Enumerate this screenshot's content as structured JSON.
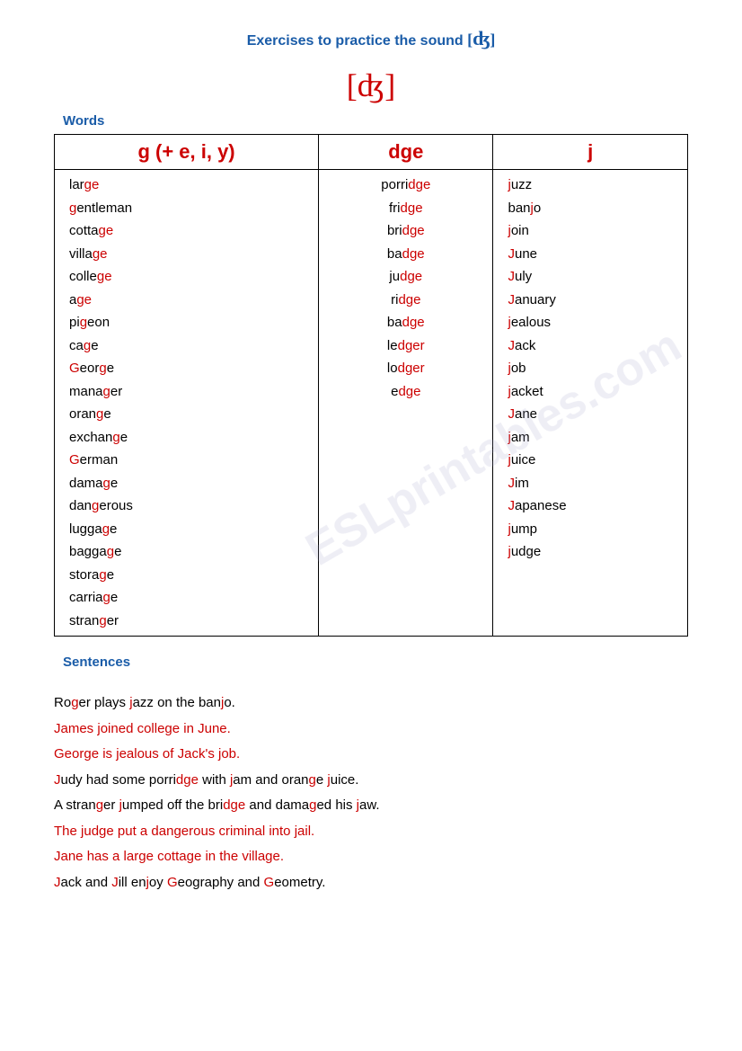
{
  "title": "Exercises to practice the sound",
  "phonetic": "[ʤ]",
  "words_label": "Words",
  "col1_header": "g  (+ e, i, y)",
  "col2_header": "dge",
  "col3_header": "j",
  "col1_words": [
    {
      "text": "lar",
      "highlight": "ge"
    },
    {
      "text": "g",
      "highlight": "g",
      "word": "gentleman",
      "pre": "",
      "mid": "g",
      "post": "entleman"
    },
    {
      "text": "cotta",
      "highlight": "ge"
    },
    {
      "text": "villa",
      "highlight": "ge"
    },
    {
      "text": "colle",
      "highlight": "ge"
    },
    {
      "text": "a",
      "highlight": "ge"
    },
    {
      "text": "pi",
      "highlight": "g",
      "post": "eon"
    },
    {
      "text": "ca",
      "highlight": "g",
      "post": "e"
    },
    {
      "text": "Geor",
      "highlight": "g",
      "post": "e"
    },
    {
      "text": "mana",
      "highlight": "g",
      "post": "er"
    },
    {
      "text": "oran",
      "highlight": "g",
      "post": "e"
    },
    {
      "text": "exchan",
      "highlight": "g",
      "post": "e"
    },
    {
      "text": "G",
      "highlight": "G",
      "post": "erman"
    },
    {
      "text": "dama",
      "highlight": "g",
      "post": "e"
    },
    {
      "text": "dan",
      "highlight": "g",
      "post": "erous"
    },
    {
      "text": "lugga",
      "highlight": "g",
      "post": "e"
    },
    {
      "text": "bagga",
      "highlight": "g",
      "post": "e"
    },
    {
      "text": "stora",
      "highlight": "g",
      "post": "e"
    },
    {
      "text": "carria",
      "highlight": "g",
      "post": "e"
    },
    {
      "text": "stran",
      "highlight": "g",
      "post": "er"
    }
  ],
  "col2_words": [
    {
      "pre": "porri",
      "highlight": "dge"
    },
    {
      "pre": "fri",
      "highlight": "dge"
    },
    {
      "pre": "bri",
      "highlight": "dge"
    },
    {
      "pre": "ba",
      "highlight": "dge"
    },
    {
      "pre": "ju",
      "highlight": "dge"
    },
    {
      "pre": "ri",
      "highlight": "dge"
    },
    {
      "pre": "ba",
      "highlight": "dge"
    },
    {
      "pre": "le",
      "highlight": "dger"
    },
    {
      "pre": "lo",
      "highlight": "dger"
    },
    {
      "pre": "e",
      "highlight": "dge"
    }
  ],
  "col3_words": [
    {
      "pre": "j",
      "highlight": "",
      "word": "juzz"
    },
    {
      "pre": "ban",
      "highlight": "",
      "word": "banjo"
    },
    {
      "pre": "j",
      "highlight": "",
      "word": "join"
    },
    {
      "pre": "J",
      "highlight": "J",
      "post": "une"
    },
    {
      "pre": "J",
      "highlight": "J",
      "post": "uly"
    },
    {
      "pre": "J",
      "highlight": "J",
      "post": "anuary"
    },
    {
      "pre": "j",
      "highlight": "j",
      "post": "ealous"
    },
    {
      "pre": "J",
      "highlight": "J",
      "post": "ack"
    },
    {
      "pre": "j",
      "highlight": "",
      "word": "job"
    },
    {
      "pre": "j",
      "highlight": "j",
      "post": "acket"
    },
    {
      "pre": "J",
      "highlight": "J",
      "post": "ane"
    },
    {
      "pre": "j",
      "highlight": "j",
      "post": "am"
    },
    {
      "pre": "j",
      "highlight": "j",
      "post": "uice"
    },
    {
      "pre": "J",
      "highlight": "J",
      "post": "im"
    },
    {
      "pre": "J",
      "highlight": "J",
      "post": "apanese"
    },
    {
      "pre": "j",
      "highlight": "j",
      "post": "ump"
    },
    {
      "pre": "j",
      "highlight": "j",
      "post": "udge"
    }
  ],
  "sentences_label": "Sentences",
  "sentences": [
    "Roger plays jazz on the banjo.",
    "James joined college in June.",
    "George is jealous of Jack's job.",
    "Judy had some porridge with jam and orange juice.",
    "A stranger jumped off the bridge and damaged his jaw.",
    "The judge put a dangerous criminal into jail.",
    "Jane has a large cottage in the village.",
    "Jack and Jill enjoy Geography and Geometry."
  ]
}
